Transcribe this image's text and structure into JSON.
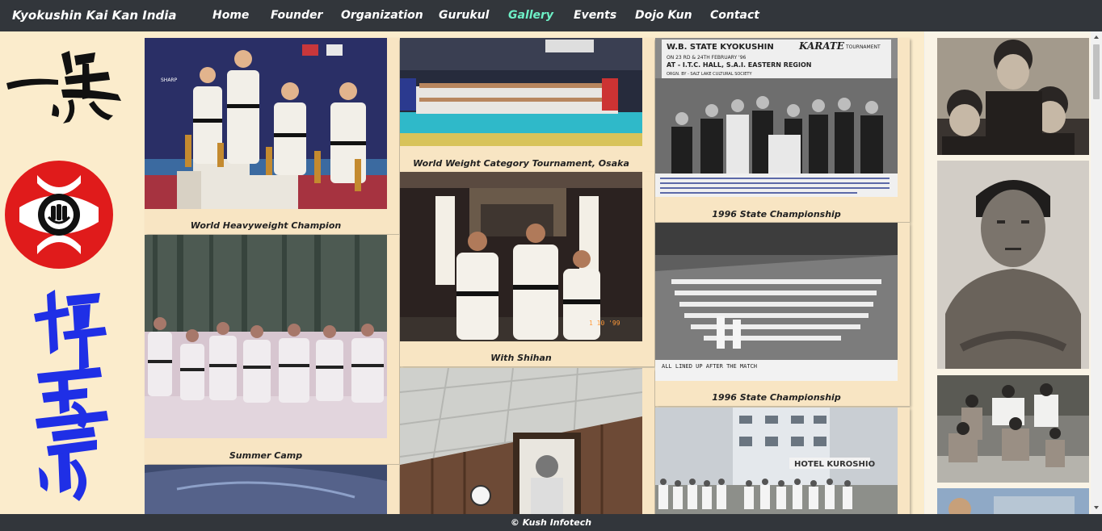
{
  "site": {
    "brand": "Kyokushin Kai Kan India"
  },
  "nav": {
    "items": [
      "Home",
      "Founder",
      "Organization",
      "Gurukul",
      "Gallery",
      "Events",
      "Dojo Kun",
      "Contact"
    ],
    "active": "Gallery"
  },
  "colors": {
    "nav_bg": "#32363b",
    "page_bg": "#fbeccc",
    "card_bg": "#f8e5c3",
    "active_link": "#6ef0c6",
    "emblem_red": "#e01b1b",
    "emblem_blue": "#1f2fe6"
  },
  "gallery": {
    "cards": [
      {
        "caption": "World Heavyweight Champion",
        "photo": "podium-champions-photo"
      },
      {
        "caption": "Summer Camp",
        "photo": "summer-camp-line-photo"
      },
      {
        "caption": "",
        "photo": "dojo-group-photo-partial"
      },
      {
        "caption": "World Weight Category Tournament, Osaka",
        "photo": "osaka-tournament-group-photo"
      },
      {
        "caption": "With Shihan",
        "photo": "with-shihan-dojo-photo"
      },
      {
        "caption": "",
        "photo": "founder-portrait-hall-photo"
      },
      {
        "caption": "1996 State Championship",
        "photo": "state-championship-ceremony-photo"
      },
      {
        "caption": "1996 State Championship",
        "photo": "state-championship-lineup-photo"
      },
      {
        "caption": "",
        "photo": "hotel-kuroshio-group-photo"
      }
    ],
    "photo_text": {
      "banner_line1": "W.B. STATE KYOKUSHIN",
      "banner_karate": "KARATE",
      "banner_line2": "TOURNAMENT",
      "banner_line3": "ON 23 RD & 24TH FEBRUARY '96",
      "banner_line4": "AT - I.T.C. HALL, S.A.I. EASTERN REGION",
      "banner_line5": "ORGN. BY - SALT LAKE CULTURAL SOCIETY",
      "lined_up": "ALL LINED UP AFTER THE MATCH",
      "hotel_sign": "HOTEL KUROSHIO",
      "sharp": "SHARP",
      "photo_date": "1 10 '99"
    }
  },
  "right_strip": {
    "photos": [
      "young-students-vintage-photo",
      "founder-portrait-photo",
      "outdoor-training-group-photo",
      "vintage-photo-partial"
    ]
  },
  "footer": {
    "text": "© Kush Infotech"
  }
}
